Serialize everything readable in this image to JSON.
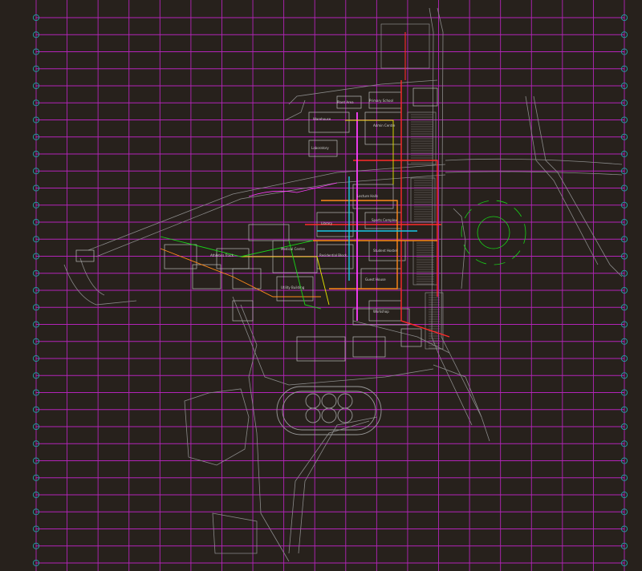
{
  "drawing": {
    "type": "CAD site master plan",
    "background_color": "#27211c",
    "grid_color": "#b324b8",
    "grid_bubble_color": "#1fa3a8",
    "road_color": "#8a8a8a",
    "utility_colors": {
      "hot_water": "#ff2a2a",
      "steam": "#ff8a1a",
      "chilled": "#e6e600",
      "domestic": "#19c8e6",
      "gas": "#ff3dff",
      "drain": "#18d618"
    },
    "grid": {
      "columns": 20,
      "rows": 33
    },
    "labels": [
      {
        "text": "Primary School"
      },
      {
        "text": "Plant Area"
      },
      {
        "text": "Warehouse"
      },
      {
        "text": "Admin Centre"
      },
      {
        "text": "Laboratory"
      },
      {
        "text": "Lecture Halls"
      },
      {
        "text": "Library"
      },
      {
        "text": "Sports Complex"
      },
      {
        "text": "Student Hostel"
      },
      {
        "text": "Residential Block"
      },
      {
        "text": "Guest House"
      },
      {
        "text": "Workshop"
      },
      {
        "text": "Medical Centre"
      },
      {
        "text": "Utility Building"
      },
      {
        "text": "Athletics Track"
      }
    ]
  }
}
